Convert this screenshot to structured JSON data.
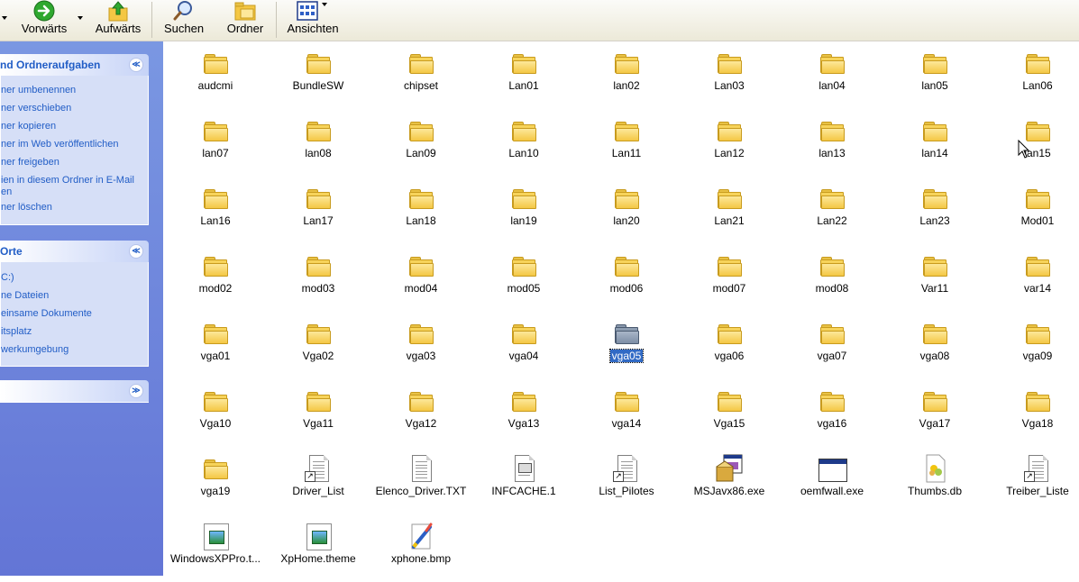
{
  "toolbar": {
    "forward_label": "Vorwärts",
    "up_label": "Aufwärts",
    "search_label": "Suchen",
    "folders_label": "Ordner",
    "views_label": "Ansichten"
  },
  "left_pane": {
    "tasks_panel": {
      "title": "nd Ordneraufgaben",
      "links": [
        "ner umbenennen",
        "ner verschieben",
        "ner kopieren",
        "ner im Web veröffentlichen",
        "ner freigeben",
        "ien in diesem Ordner in E-Mail",
        "en",
        "ner löschen"
      ]
    },
    "places_panel": {
      "title": "Orte",
      "links": [
        "C:)",
        "ne Dateien",
        "einsame Dokumente",
        "itsplatz",
        "werkumgebung"
      ]
    },
    "collapse_glyph_up": "≪",
    "collapse_glyph_down": "≫"
  },
  "content": {
    "items": [
      {
        "name": "audcmi",
        "type": "folder"
      },
      {
        "name": "BundleSW",
        "type": "folder"
      },
      {
        "name": "chipset",
        "type": "folder"
      },
      {
        "name": "Lan01",
        "type": "folder"
      },
      {
        "name": "lan02",
        "type": "folder"
      },
      {
        "name": "Lan03",
        "type": "folder"
      },
      {
        "name": "lan04",
        "type": "folder"
      },
      {
        "name": "lan05",
        "type": "folder"
      },
      {
        "name": "Lan06",
        "type": "folder"
      },
      {
        "name": "lan07",
        "type": "folder"
      },
      {
        "name": "lan08",
        "type": "folder"
      },
      {
        "name": "Lan09",
        "type": "folder"
      },
      {
        "name": "Lan10",
        "type": "folder"
      },
      {
        "name": "Lan11",
        "type": "folder"
      },
      {
        "name": "Lan12",
        "type": "folder"
      },
      {
        "name": "lan13",
        "type": "folder"
      },
      {
        "name": "lan14",
        "type": "folder"
      },
      {
        "name": "lan15",
        "type": "folder"
      },
      {
        "name": "Lan16",
        "type": "folder"
      },
      {
        "name": "Lan17",
        "type": "folder"
      },
      {
        "name": "Lan18",
        "type": "folder"
      },
      {
        "name": "lan19",
        "type": "folder"
      },
      {
        "name": "lan20",
        "type": "folder"
      },
      {
        "name": "Lan21",
        "type": "folder"
      },
      {
        "name": "Lan22",
        "type": "folder"
      },
      {
        "name": "Lan23",
        "type": "folder"
      },
      {
        "name": "Mod01",
        "type": "folder"
      },
      {
        "name": "mod02",
        "type": "folder"
      },
      {
        "name": "mod03",
        "type": "folder"
      },
      {
        "name": "mod04",
        "type": "folder"
      },
      {
        "name": "mod05",
        "type": "folder"
      },
      {
        "name": "mod06",
        "type": "folder"
      },
      {
        "name": "mod07",
        "type": "folder"
      },
      {
        "name": "mod08",
        "type": "folder"
      },
      {
        "name": "Var11",
        "type": "folder"
      },
      {
        "name": "var14",
        "type": "folder"
      },
      {
        "name": "vga01",
        "type": "folder"
      },
      {
        "name": "Vga02",
        "type": "folder"
      },
      {
        "name": "vga03",
        "type": "folder"
      },
      {
        "name": "vga04",
        "type": "folder"
      },
      {
        "name": "vga05",
        "type": "folder",
        "selected": true
      },
      {
        "name": "vga06",
        "type": "folder"
      },
      {
        "name": "vga07",
        "type": "folder"
      },
      {
        "name": "vga08",
        "type": "folder"
      },
      {
        "name": "vga09",
        "type": "folder"
      },
      {
        "name": "Vga10",
        "type": "folder"
      },
      {
        "name": "Vga11",
        "type": "folder"
      },
      {
        "name": "Vga12",
        "type": "folder"
      },
      {
        "name": "Vga13",
        "type": "folder"
      },
      {
        "name": "vga14",
        "type": "folder"
      },
      {
        "name": "Vga15",
        "type": "folder"
      },
      {
        "name": "vga16",
        "type": "folder"
      },
      {
        "name": "Vga17",
        "type": "folder"
      },
      {
        "name": "Vga18",
        "type": "folder"
      },
      {
        "name": "vga19",
        "type": "folder"
      },
      {
        "name": "Driver_List",
        "type": "shortcut-doc"
      },
      {
        "name": "Elenco_Driver.TXT",
        "type": "doc"
      },
      {
        "name": "INFCACHE.1",
        "type": "sysfile"
      },
      {
        "name": "List_Pilotes",
        "type": "shortcut-doc"
      },
      {
        "name": "MSJavx86.exe",
        "type": "installer"
      },
      {
        "name": "oemfwall.exe",
        "type": "exe"
      },
      {
        "name": "Thumbs.db",
        "type": "db"
      },
      {
        "name": "Treiber_Liste",
        "type": "shortcut-doc"
      },
      {
        "name": "WindowsXPPro.t...",
        "type": "theme"
      },
      {
        "name": "XpHome.theme",
        "type": "theme"
      },
      {
        "name": "xphone.bmp",
        "type": "bitmap"
      }
    ]
  }
}
